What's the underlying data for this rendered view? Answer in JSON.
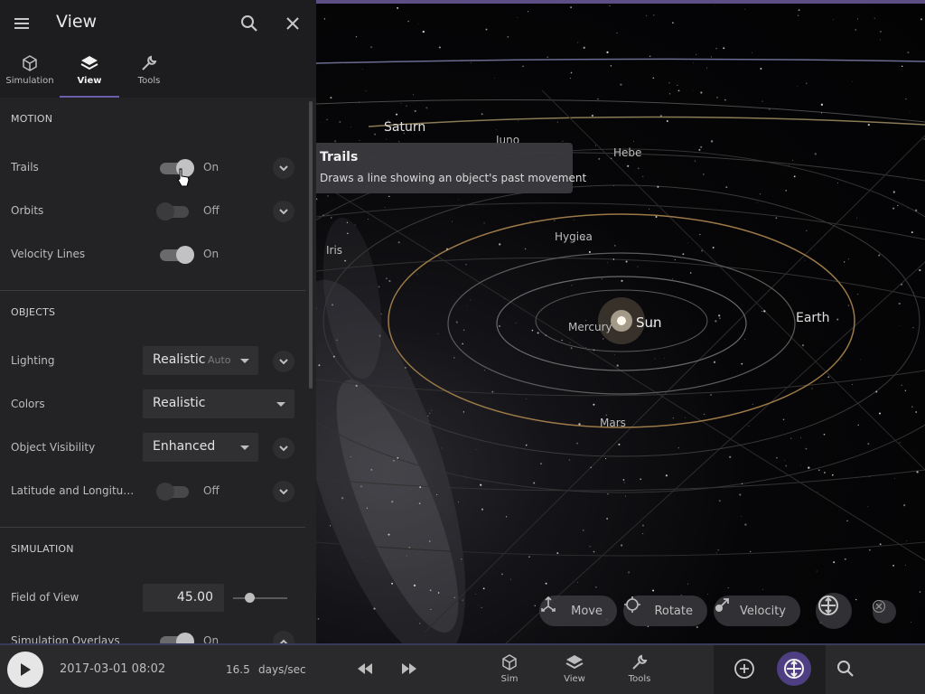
{
  "panel": {
    "title": "View",
    "tabs": [
      {
        "label": "Simulation",
        "icon": "cube-icon"
      },
      {
        "label": "View",
        "icon": "layers-icon"
      },
      {
        "label": "Tools",
        "icon": "wrench-icon"
      }
    ],
    "active_tab": "View",
    "motion": {
      "header": "MOTION",
      "trails": {
        "label": "Trails",
        "state": "On"
      },
      "orbits": {
        "label": "Orbits",
        "state": "Off"
      },
      "velocity_lines": {
        "label": "Velocity Lines",
        "state": "On"
      }
    },
    "objects": {
      "header": "OBJECTS",
      "lighting": {
        "label": "Lighting",
        "value": "Realistic",
        "sub": "Auto"
      },
      "colors": {
        "label": "Colors",
        "value": "Realistic"
      },
      "object_visibility": {
        "label": "Object Visibility",
        "value": "Enhanced"
      },
      "lat_long": {
        "label": "Latitude and Longitud...",
        "state": "Off"
      }
    },
    "simulation": {
      "header": "SIMULATION",
      "field_of_view": {
        "label": "Field of View",
        "value": "45.00",
        "slider_fraction": 0.25
      },
      "overlays": {
        "label": "Simulation Overlays",
        "state": "On"
      }
    }
  },
  "tooltip": {
    "title": "Trails",
    "text": "Draws a line showing an object's past movement"
  },
  "bodies": {
    "saturn": "Saturn",
    "juno": "Juno",
    "hebe": "Hebe",
    "hygiea": "Hygiea",
    "iris": "Iris",
    "mercury": "Mercury",
    "sun": "Sun",
    "earth": "Earth",
    "mars": "Mars"
  },
  "controls": {
    "move": "Move",
    "rotate": "Rotate",
    "velocity": "Velocity"
  },
  "bottombar": {
    "date": "2017-03-01 08:02",
    "rate": "16.5",
    "rate_unit": "days/sec",
    "tabs": [
      {
        "label": "Sim",
        "icon": "cube-icon"
      },
      {
        "label": "View",
        "icon": "layers-icon"
      },
      {
        "label": "Tools",
        "icon": "wrench-icon"
      }
    ]
  },
  "colors": {
    "accent": "#6b5ea8",
    "panel_bg": "#232325",
    "topline": "#5e4e86"
  }
}
